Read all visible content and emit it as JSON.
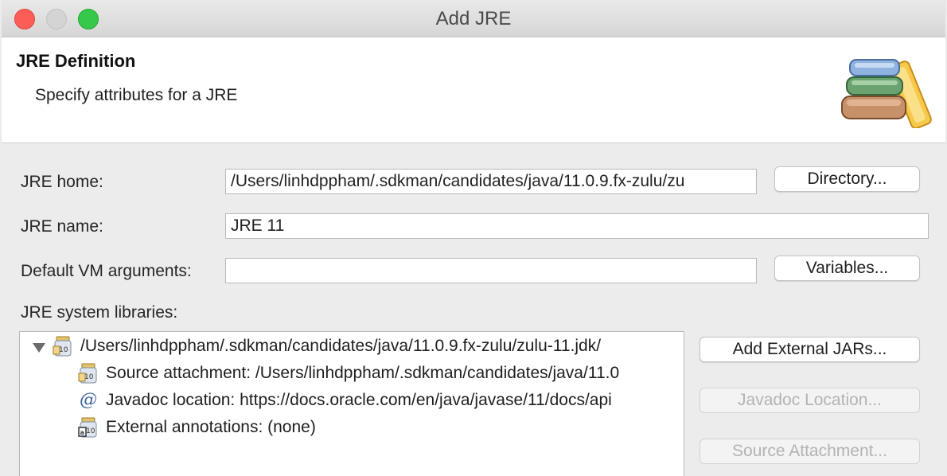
{
  "window": {
    "title": "Add JRE"
  },
  "banner": {
    "title": "JRE Definition",
    "description": "Specify attributes for a JRE",
    "icon": "books-icon"
  },
  "form": {
    "jre_home_label": "JRE home:",
    "jre_home_value": "/Users/linhdppham/.sdkman/candidates/java/11.0.9.fx-zulu/zu",
    "directory_button": "Directory...",
    "jre_name_label": "JRE name:",
    "jre_name_value": "JRE 11",
    "vm_args_label": "Default VM arguments:",
    "vm_args_value": "",
    "variables_button": "Variables...",
    "libraries_label": "JRE system libraries:"
  },
  "libraries": {
    "root": {
      "label": "/Users/linhdppham/.sdkman/candidates/java/11.0.9.fx-zulu/zulu-11.jdk/",
      "icon": "jar-icon",
      "expanded": true
    },
    "children": [
      {
        "label": "Source attachment: /Users/linhdppham/.sdkman/candidates/java/11.0",
        "icon": "source-jar-icon"
      },
      {
        "label": "Javadoc location: https://docs.oracle.com/en/java/javase/11/docs/api",
        "icon": "at-sign-icon"
      },
      {
        "label": "External annotations: (none)",
        "icon": "annotations-jar-icon"
      }
    ]
  },
  "side_buttons": {
    "add_external_jars": "Add External JARs...",
    "javadoc_location": "Javadoc Location...",
    "source_attachment": "Source Attachment..."
  }
}
